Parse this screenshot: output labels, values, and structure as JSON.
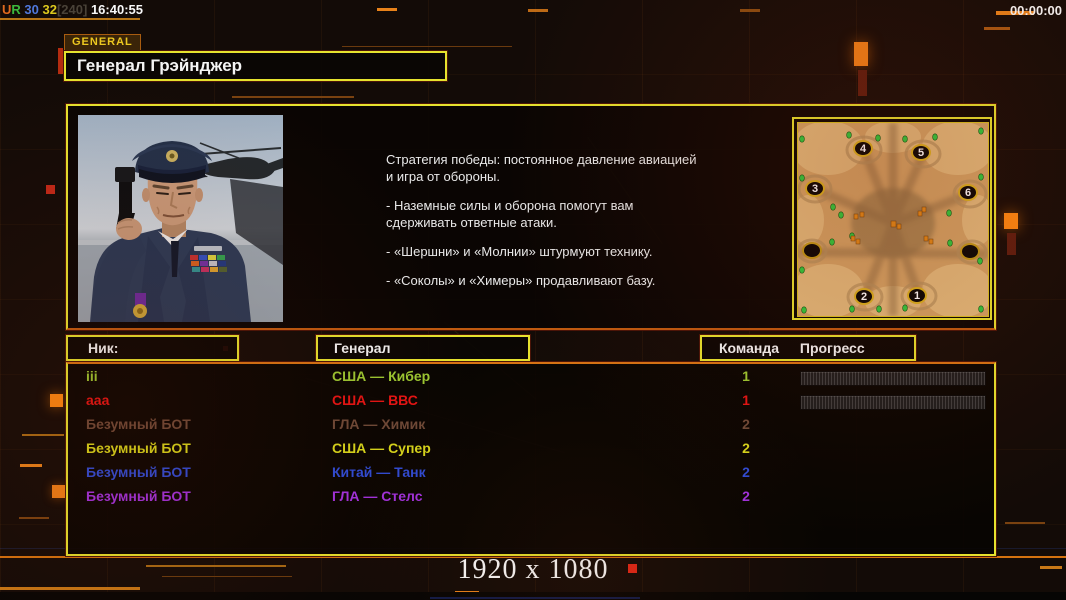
{
  "topbar": {
    "parts": [
      {
        "text": "U",
        "color": "#e06a1e"
      },
      {
        "text": "R",
        "color": "#3cb83c"
      },
      {
        "text": "30",
        "color": "#5078dc"
      },
      {
        "text": "32",
        "color": "#dcc81e"
      },
      {
        "text": "[240]",
        "color": "#4a4238"
      },
      {
        "text": "16:40:55",
        "color": "#f8f8f8"
      }
    ],
    "timer": "00:00:00"
  },
  "general_tab": {
    "label": "GENERAL"
  },
  "title": {
    "text": "Генерал Грэйнджер"
  },
  "strategy": {
    "p1": "Стратегия победы: постоянное давление авиацией\n и игра от обороны.",
    "p2": "- Наземные силы и оборона помогут вам\n сдерживать ответные атаки.",
    "p3": "- «Шершни» и «Молнии» штурмуют технику.",
    "p4": "- «Соколы» и «Химеры» продавливают базу."
  },
  "minimap": {
    "markers": [
      "4",
      "5",
      "3",
      "6",
      "2",
      "1"
    ]
  },
  "headers": {
    "nick": "Ник:",
    "general": "Генерал",
    "team": "Команда",
    "progress": "Прогресс"
  },
  "players": [
    {
      "nick": "iii",
      "general": "США — Кибер",
      "team": "1",
      "color": "#9cc832",
      "progress": true
    },
    {
      "nick": "aaa",
      "general": "США — ВВС",
      "team": "1",
      "color": "#e61414",
      "progress": true
    },
    {
      "nick": "Безумный БОТ",
      "general": "ГЛА — Химик",
      "team": "2",
      "color": "#6e4a38",
      "progress": false
    },
    {
      "nick": "Безумный БОТ",
      "general": "США — Супер",
      "team": "2",
      "color": "#d8d81c",
      "progress": false
    },
    {
      "nick": "Безумный БОТ",
      "general": "Китай — Танк",
      "team": "2",
      "color": "#2e4cd8",
      "progress": false
    },
    {
      "nick": "Безумный БОТ",
      "general": "ГЛА — Стелс",
      "team": "2",
      "color": "#a232e0",
      "progress": false
    }
  ],
  "footer": {
    "resolution": "1920 x 1080"
  },
  "colors": {
    "border_yellow": "#e6e22e",
    "deco_orange": "#e8821a",
    "map_marker_ring": "#d8b020",
    "map_sand": "#d2a264"
  }
}
